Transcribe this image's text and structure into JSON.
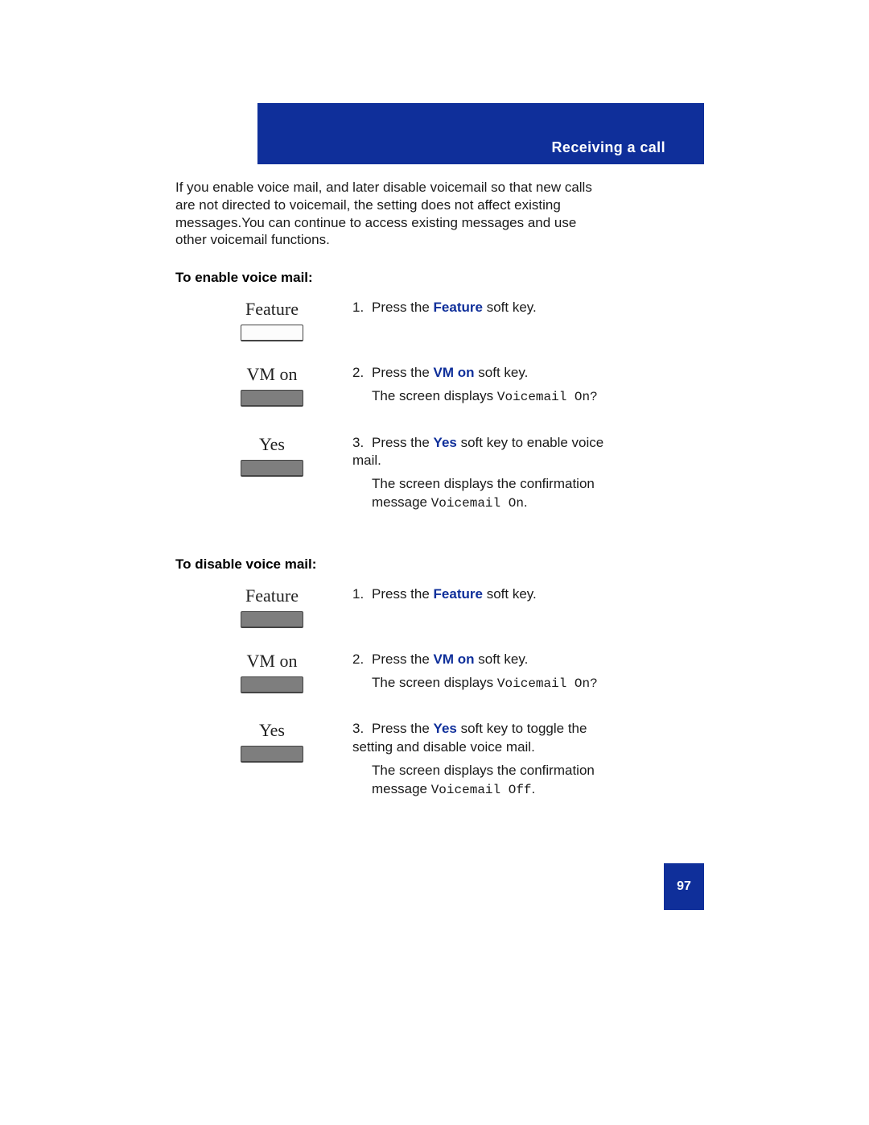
{
  "header": {
    "title": "Receiving a call"
  },
  "intro": "If you enable voice mail, and later disable voicemail so that new calls are not directed to voicemail, the setting does not affect existing messages.You can continue to access existing messages and use other voicemail functions.",
  "enable": {
    "heading": "To enable voice mail:",
    "step1": {
      "key_label": "Feature",
      "num": "1.",
      "prefix": "Press the ",
      "softkey": "Feature",
      "suffix": " soft key."
    },
    "step2": {
      "key_label": "VM on",
      "num": "2.",
      "prefix": "Press the ",
      "softkey": "VM on",
      "suffix": " soft key.",
      "line2a": "The screen displays ",
      "line2b": "Voicemail On?"
    },
    "step3": {
      "key_label": "Yes",
      "num": "3.",
      "prefix": "Press the ",
      "softkey": "Yes",
      "suffix": " soft key to enable voice mail.",
      "line2a": "The screen displays the confirmation message ",
      "line2b": "Voicemail On",
      "line2c": "."
    }
  },
  "disable": {
    "heading": "To disable voice mail:",
    "step1": {
      "key_label": "Feature",
      "num": "1.",
      "prefix": "Press the ",
      "softkey": "Feature",
      "suffix": " soft key."
    },
    "step2": {
      "key_label": "VM on",
      "num": "2.",
      "prefix": "Press the ",
      "softkey": "VM on",
      "suffix": " soft key.",
      "line2a": "The screen displays ",
      "line2b": "Voicemail On?"
    },
    "step3": {
      "key_label": "Yes",
      "num": "3.",
      "prefix": "Press the ",
      "softkey": "Yes",
      "suffix": " soft key to toggle the setting and disable voice mail.",
      "line2a": "The screen displays the confirmation message ",
      "line2b": "Voicemail Off",
      "line2c": "."
    }
  },
  "page_number": "97"
}
